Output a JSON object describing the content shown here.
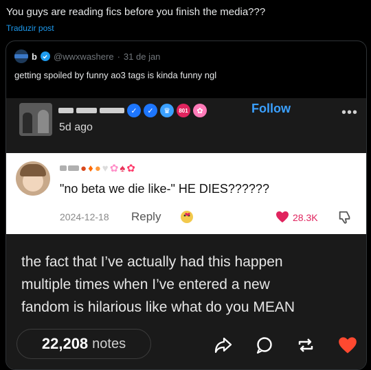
{
  "post": {
    "text": "You guys are reading fics before you finish the media???",
    "translate_label": "Traduzir post"
  },
  "quote": {
    "name": "b",
    "handle": "@wwxwashere",
    "separator": "·",
    "date": "31 de jan",
    "text": "getting spoiled by funny ao3 tags is kinda funny ngl"
  },
  "screenshot": {
    "header": {
      "follow_label": "Follow",
      "more_label": "•••",
      "time_ago": "5d ago",
      "badge_label": "801"
    },
    "reply": {
      "text": "\"no beta we die like-\" HE DIES??????",
      "date": "2024-12-18",
      "reply_label": "Reply",
      "likes": "28.3K"
    },
    "body_lines": [
      "the fact that I’ve actually had this happen",
      "multiple times when I’ve entered a new",
      "fandom is hilarious like what do you MEAN"
    ],
    "notes_count": "22,208",
    "notes_label": "notes"
  },
  "colors": {
    "x_link": "#1d9bf0",
    "tumblr_follow": "#3aa0ff",
    "like_red": "#e0245e",
    "heart_active": "#ff4930"
  }
}
